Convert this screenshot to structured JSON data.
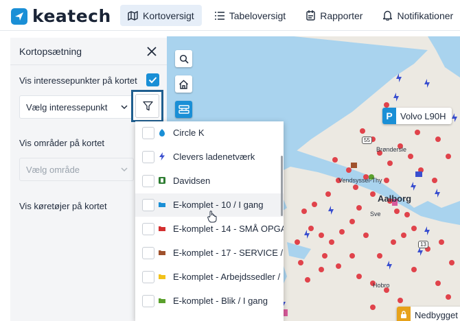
{
  "brand": {
    "name": "keatech"
  },
  "nav": {
    "items": [
      {
        "label": "Kortoversigt",
        "icon": "map-icon",
        "active": true
      },
      {
        "label": "Tabeloversigt",
        "icon": "list-icon",
        "active": false
      },
      {
        "label": "Rapporter",
        "icon": "report-icon",
        "active": false
      },
      {
        "label": "Notifikationer",
        "icon": "bell-icon",
        "active": false
      }
    ]
  },
  "panel": {
    "title": "Kortopsætning",
    "poi_label": "Vis interessepunkter på kortet",
    "poi_checked": true,
    "poi_placeholder": "Vælg interessepunkt",
    "areas_label": "Vis områder på kortet",
    "areas_placeholder": "Vælg område",
    "vehicles_label": "Vis køretøjer på kortet"
  },
  "dropdown": {
    "items": [
      {
        "label": "Circle K",
        "icon": "circle-k-icon",
        "color": "#1a8fd6",
        "checked": false
      },
      {
        "label": "Clevers ladenetværk",
        "icon": "lightning-icon",
        "color": "#3a4fcf",
        "checked": false
      },
      {
        "label": "Davidsen",
        "icon": "davidsen-icon",
        "color": "#2e7d32",
        "checked": false
      },
      {
        "label": "E-komplet - 10 / I gang",
        "icon": "folder-icon",
        "color": "#1a8fd6",
        "checked": false,
        "hover": true
      },
      {
        "label": "E-komplet - 14 - SMÅ OPGA",
        "icon": "folder-icon",
        "color": "#d32f2f",
        "checked": false
      },
      {
        "label": "E-komplet - 17 - SERVICE / ",
        "icon": "folder-icon",
        "color": "#a0522d",
        "checked": false
      },
      {
        "label": "E-komplet - Arbejdssedler / ",
        "icon": "folder-icon",
        "color": "#f2c21b",
        "checked": false
      },
      {
        "label": "E-komplet - Blik / I gang",
        "icon": "folder-icon",
        "color": "#5aa02c",
        "checked": false
      }
    ]
  },
  "map": {
    "vehicle_label": "Volvo L90H",
    "vehicle_badge": "P",
    "status_chip": "Nedbygget",
    "place_labels": [
      "Brøndersle",
      "Vendsyssel-Thy",
      "Aalborg",
      "Sve",
      "Hobro"
    ],
    "road_badges": [
      "55",
      "13"
    ]
  },
  "colors": {
    "accent": "#1a8fd6",
    "water": "#a9d3ee",
    "land": "#ece9e2",
    "marker_red": "#e0434b",
    "charger_blue": "#3a4fcf"
  }
}
